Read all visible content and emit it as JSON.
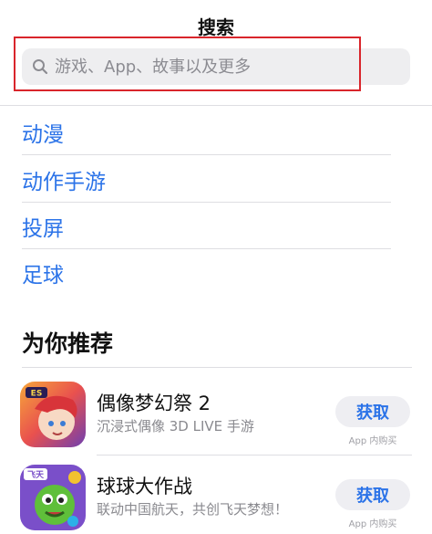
{
  "header": {
    "title": "搜索"
  },
  "search": {
    "placeholder": "游戏、App、故事以及更多",
    "icon": "search-icon"
  },
  "suggestions": [
    {
      "label": "动漫"
    },
    {
      "label": "动作手游"
    },
    {
      "label": "投屏"
    },
    {
      "label": "足球"
    }
  ],
  "recommended": {
    "title": "为你推荐",
    "apps": [
      {
        "name": "偶像梦幻祭 2",
        "subtitle": "沉浸式偶像 3D LIVE 手游",
        "button": "获取",
        "note": "App 内购买",
        "icon_badge": "ES"
      },
      {
        "name": "球球大作战",
        "subtitle": "联动中国航天，共创飞天梦想！",
        "button": "获取",
        "note": "App 内购买",
        "icon_badge": "飞天"
      }
    ]
  },
  "colors": {
    "accent": "#2b73e8",
    "highlight_box": "#d9252b",
    "search_bg": "#eeeef0"
  }
}
